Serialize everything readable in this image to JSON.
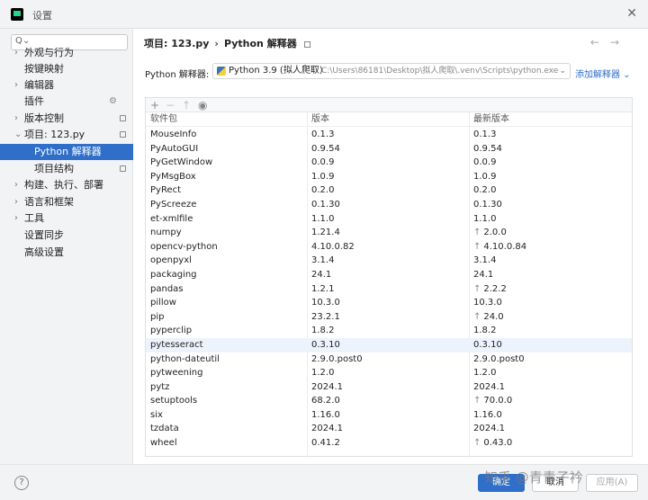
{
  "window": {
    "title": "设置"
  },
  "sidebar": {
    "search_placeholder": "",
    "items": [
      {
        "label": "外观与行为",
        "arrow": "›"
      },
      {
        "label": "按键映射",
        "arrow": ""
      },
      {
        "label": "编辑器",
        "arrow": "›"
      },
      {
        "label": "插件",
        "arrow": ""
      },
      {
        "label": "版本控制",
        "arrow": "›"
      },
      {
        "label": "项目: 123.py",
        "arrow": "⌄"
      },
      {
        "label": "Python 解释器",
        "arrow": ""
      },
      {
        "label": "项目结构",
        "arrow": ""
      },
      {
        "label": "构建、执行、部署",
        "arrow": "›"
      },
      {
        "label": "语言和框架",
        "arrow": "›"
      },
      {
        "label": "工具",
        "arrow": "›"
      },
      {
        "label": "设置同步",
        "arrow": ""
      },
      {
        "label": "高级设置",
        "arrow": ""
      }
    ]
  },
  "breadcrumb": {
    "project": "项目: 123.py",
    "separator": "›",
    "page": "Python 解释器"
  },
  "interpreter": {
    "label": "Python 解释器:",
    "name": "Python 3.9 (拟人爬取)",
    "path": "C:\\Users\\86181\\Desktop\\拟人爬取\\.venv\\Scripts\\python.exe",
    "add_label": "添加解释器 ⌄"
  },
  "table": {
    "headers": {
      "package": "软件包",
      "version": "版本",
      "latest": "最新版本"
    },
    "rows": [
      {
        "package": "MouseInfo",
        "version": "0.1.3",
        "latest": "0.1.3",
        "upgrade": false
      },
      {
        "package": "PyAutoGUI",
        "version": "0.9.54",
        "latest": "0.9.54",
        "upgrade": false
      },
      {
        "package": "PyGetWindow",
        "version": "0.0.9",
        "latest": "0.0.9",
        "upgrade": false
      },
      {
        "package": "PyMsgBox",
        "version": "1.0.9",
        "latest": "1.0.9",
        "upgrade": false
      },
      {
        "package": "PyRect",
        "version": "0.2.0",
        "latest": "0.2.0",
        "upgrade": false
      },
      {
        "package": "PyScreeze",
        "version": "0.1.30",
        "latest": "0.1.30",
        "upgrade": false
      },
      {
        "package": "et-xmlfile",
        "version": "1.1.0",
        "latest": "1.1.0",
        "upgrade": false
      },
      {
        "package": "numpy",
        "version": "1.21.4",
        "latest": "2.0.0",
        "upgrade": true
      },
      {
        "package": "opencv-python",
        "version": "4.10.0.82",
        "latest": "4.10.0.84",
        "upgrade": true
      },
      {
        "package": "openpyxl",
        "version": "3.1.4",
        "latest": "3.1.4",
        "upgrade": false
      },
      {
        "package": "packaging",
        "version": "24.1",
        "latest": "24.1",
        "upgrade": false
      },
      {
        "package": "pandas",
        "version": "1.2.1",
        "latest": "2.2.2",
        "upgrade": true
      },
      {
        "package": "pillow",
        "version": "10.3.0",
        "latest": "10.3.0",
        "upgrade": false
      },
      {
        "package": "pip",
        "version": "23.2.1",
        "latest": "24.0",
        "upgrade": true
      },
      {
        "package": "pyperclip",
        "version": "1.8.2",
        "latest": "1.8.2",
        "upgrade": false
      },
      {
        "package": "pytesseract",
        "version": "0.3.10",
        "latest": "0.3.10",
        "upgrade": false
      },
      {
        "package": "python-dateutil",
        "version": "2.9.0.post0",
        "latest": "2.9.0.post0",
        "upgrade": false
      },
      {
        "package": "pytweening",
        "version": "1.2.0",
        "latest": "1.2.0",
        "upgrade": false
      },
      {
        "package": "pytz",
        "version": "2024.1",
        "latest": "2024.1",
        "upgrade": false
      },
      {
        "package": "setuptools",
        "version": "68.2.0",
        "latest": "70.0.0",
        "upgrade": true
      },
      {
        "package": "six",
        "version": "1.16.0",
        "latest": "1.16.0",
        "upgrade": false
      },
      {
        "package": "tzdata",
        "version": "2024.1",
        "latest": "2024.1",
        "upgrade": false
      },
      {
        "package": "wheel",
        "version": "0.41.2",
        "latest": "0.43.0",
        "upgrade": true
      }
    ]
  },
  "footer": {
    "help": "?",
    "ok": "确定",
    "cancel": "取消",
    "apply": "应用(A)"
  },
  "watermark": "知乎 @青青子衿",
  "colors": {
    "accent": "#2f6fca",
    "selected_bg": "#2f6fca",
    "highlight_row": "#edf3fd"
  }
}
